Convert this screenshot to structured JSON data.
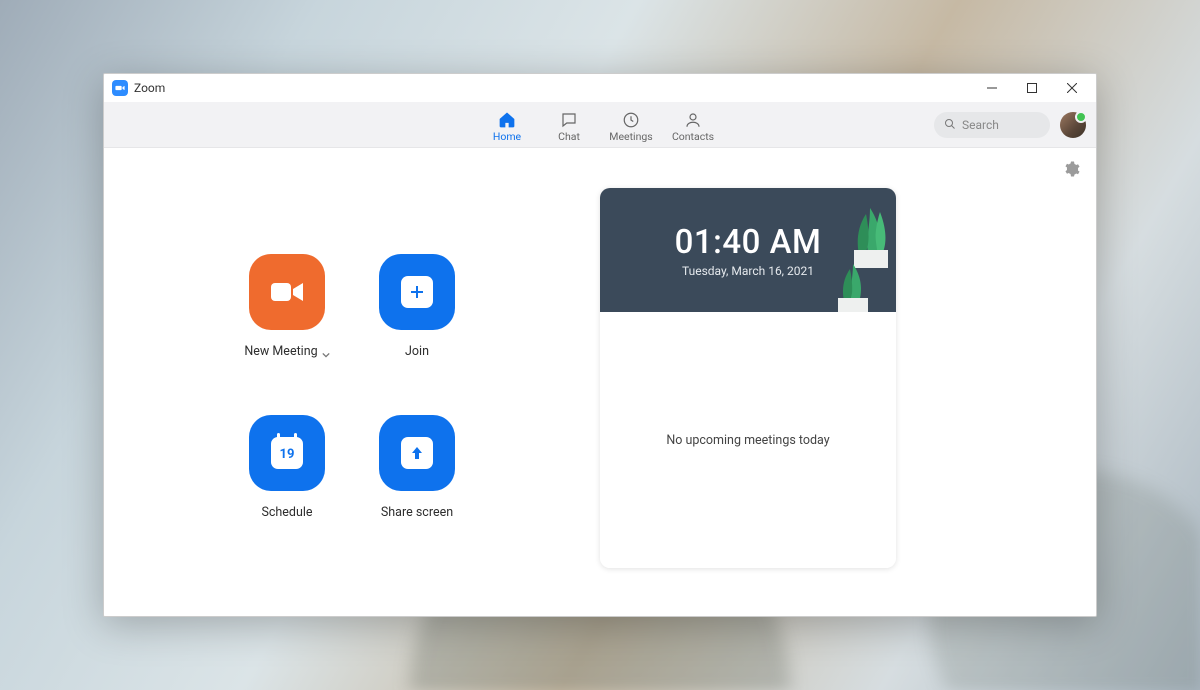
{
  "window": {
    "title": "Zoom"
  },
  "nav": {
    "tabs": [
      {
        "label": "Home"
      },
      {
        "label": "Chat"
      },
      {
        "label": "Meetings"
      },
      {
        "label": "Contacts"
      }
    ],
    "search_placeholder": "Search"
  },
  "actions": {
    "new_meeting": "New Meeting",
    "join": "Join",
    "schedule": "Schedule",
    "schedule_day": "19",
    "share_screen": "Share screen"
  },
  "calendar": {
    "time": "01:40 AM",
    "date": "Tuesday, March 16, 2021",
    "empty_message": "No upcoming meetings today"
  }
}
